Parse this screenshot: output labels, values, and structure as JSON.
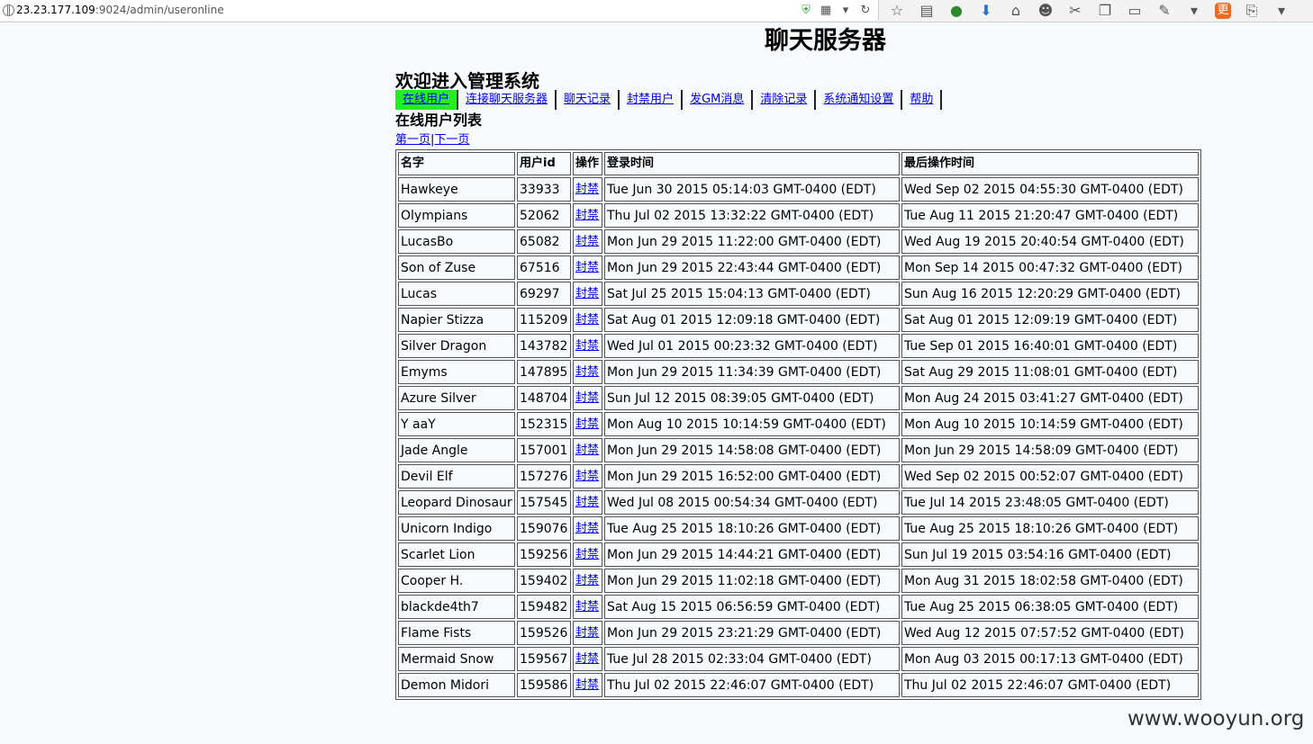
{
  "browser": {
    "url_host": "23.23.177.109",
    "url_path": ":9024/admin/useronline"
  },
  "page": {
    "title": "聊天服务器",
    "welcome": "欢迎进入管理系统",
    "section_title": "在线用户列表"
  },
  "nav": [
    {
      "label": "在线用户",
      "active": true
    },
    {
      "label": "连接聊天服务器",
      "active": false
    },
    {
      "label": "聊天记录",
      "active": false
    },
    {
      "label": "封禁用户",
      "active": false
    },
    {
      "label": "发GM消息",
      "active": false
    },
    {
      "label": "清除记录",
      "active": false
    },
    {
      "label": "系统通知设置",
      "active": false
    },
    {
      "label": "帮助",
      "active": false
    }
  ],
  "pager": {
    "first": "第一页",
    "separator": "|",
    "next": "下一页"
  },
  "table": {
    "headers": [
      "名字",
      "用户id",
      "操作",
      "登录时间",
      "最后操作时间"
    ],
    "action_label": "封禁",
    "rows": [
      [
        "Hawkeye",
        "33933",
        "Tue Jun 30 2015 05:14:03 GMT-0400 (EDT)",
        "Wed Sep 02 2015 04:55:30 GMT-0400 (EDT)"
      ],
      [
        "Olympians",
        "52062",
        "Thu Jul 02 2015 13:32:22 GMT-0400 (EDT)",
        "Tue Aug 11 2015 21:20:47 GMT-0400 (EDT)"
      ],
      [
        "LucasBo",
        "65082",
        "Mon Jun 29 2015 11:22:00 GMT-0400 (EDT)",
        "Wed Aug 19 2015 20:40:54 GMT-0400 (EDT)"
      ],
      [
        "Son of Zuse",
        "67516",
        "Mon Jun 29 2015 22:43:44 GMT-0400 (EDT)",
        "Mon Sep 14 2015 00:47:32 GMT-0400 (EDT)"
      ],
      [
        "Lucas",
        "69297",
        "Sat Jul 25 2015 15:04:13 GMT-0400 (EDT)",
        "Sun Aug 16 2015 12:20:29 GMT-0400 (EDT)"
      ],
      [
        "Napier Stizza",
        "115209",
        "Sat Aug 01 2015 12:09:18 GMT-0400 (EDT)",
        "Sat Aug 01 2015 12:09:19 GMT-0400 (EDT)"
      ],
      [
        "Silver Dragon",
        "143782",
        "Wed Jul 01 2015 00:23:32 GMT-0400 (EDT)",
        "Tue Sep 01 2015 16:40:01 GMT-0400 (EDT)"
      ],
      [
        "Emyms",
        "147895",
        "Mon Jun 29 2015 11:34:39 GMT-0400 (EDT)",
        "Sat Aug 29 2015 11:08:01 GMT-0400 (EDT)"
      ],
      [
        "Azure Silver",
        "148704",
        "Sun Jul 12 2015 08:39:05 GMT-0400 (EDT)",
        "Mon Aug 24 2015 03:41:27 GMT-0400 (EDT)"
      ],
      [
        "Y aaY",
        "152315",
        "Mon Aug 10 2015 10:14:59 GMT-0400 (EDT)",
        "Mon Aug 10 2015 10:14:59 GMT-0400 (EDT)"
      ],
      [
        "Jade Angle",
        "157001",
        "Mon Jun 29 2015 14:58:08 GMT-0400 (EDT)",
        "Mon Jun 29 2015 14:58:09 GMT-0400 (EDT)"
      ],
      [
        "Devil Elf",
        "157276",
        "Mon Jun 29 2015 16:52:00 GMT-0400 (EDT)",
        "Wed Sep 02 2015 00:52:07 GMT-0400 (EDT)"
      ],
      [
        "Leopard Dinosaur",
        "157545",
        "Wed Jul 08 2015 00:54:34 GMT-0400 (EDT)",
        "Tue Jul 14 2015 23:48:05 GMT-0400 (EDT)"
      ],
      [
        "Unicorn Indigo",
        "159076",
        "Tue Aug 25 2015 18:10:26 GMT-0400 (EDT)",
        "Tue Aug 25 2015 18:10:26 GMT-0400 (EDT)"
      ],
      [
        "Scarlet Lion",
        "159256",
        "Mon Jun 29 2015 14:44:21 GMT-0400 (EDT)",
        "Sun Jul 19 2015 03:54:16 GMT-0400 (EDT)"
      ],
      [
        "Cooper H.",
        "159402",
        "Mon Jun 29 2015 11:02:18 GMT-0400 (EDT)",
        "Mon Aug 31 2015 18:02:58 GMT-0400 (EDT)"
      ],
      [
        "blackde4th7",
        "159482",
        "Sat Aug 15 2015 06:56:59 GMT-0400 (EDT)",
        "Tue Aug 25 2015 06:38:05 GMT-0400 (EDT)"
      ],
      [
        "Flame Fists",
        "159526",
        "Mon Jun 29 2015 23:21:29 GMT-0400 (EDT)",
        "Wed Aug 12 2015 07:57:52 GMT-0400 (EDT)"
      ],
      [
        "Mermaid Snow",
        "159567",
        "Tue Jul 28 2015 02:33:04 GMT-0400 (EDT)",
        "Mon Aug 03 2015 00:17:13 GMT-0400 (EDT)"
      ],
      [
        "Demon Midori",
        "159586",
        "Thu Jul 02 2015 22:46:07 GMT-0400 (EDT)",
        "Thu Jul 02 2015 22:46:07 GMT-0400 (EDT)"
      ]
    ]
  },
  "watermark": "www.wooyun.org",
  "icons": {
    "url_bar": [
      "shield-icon",
      "qr-code-icon",
      "dropdown-icon",
      "refresh-icon"
    ],
    "toolbar": [
      "star-icon",
      "reading-list-icon",
      "extension-icon",
      "download-icon",
      "home-icon",
      "chat-icon",
      "scissors-icon",
      "copy-icon",
      "clipboard-icon",
      "tools-icon",
      "menu-arrow-icon",
      "translate-icon",
      "share-icon",
      "overflow-icon"
    ]
  }
}
